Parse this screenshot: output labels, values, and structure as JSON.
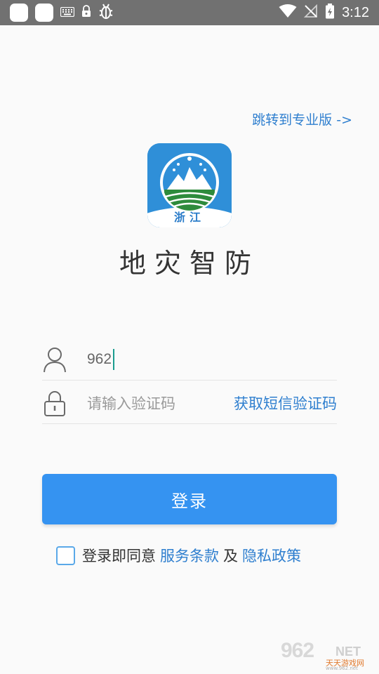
{
  "status_bar": {
    "time": "3:12",
    "icons": [
      "app-square-icon",
      "app-square-icon",
      "keyboard-icon",
      "lock-icon",
      "bug-icon",
      "wifi-icon",
      "no-sim-icon",
      "battery-icon"
    ]
  },
  "header": {
    "pro_link": "跳转到专业版 ->"
  },
  "logo": {
    "text": "浙江"
  },
  "app_title": "地灾智防",
  "form": {
    "phone_value": "962",
    "code_placeholder": "请输入验证码",
    "sms_button": "获取短信验证码"
  },
  "login_button": "登录",
  "agreement": {
    "prefix": "登录即同意",
    "terms": "服务条款",
    "and": "及",
    "privacy": "隐私政策",
    "checked": false
  },
  "watermark": {
    "main": "962",
    "net": "NET",
    "cn": "天天游戏网",
    "url": "www.962.net"
  },
  "colors": {
    "accent": "#3593f1",
    "link": "#2f7fcf",
    "status_bar": "#717171"
  }
}
